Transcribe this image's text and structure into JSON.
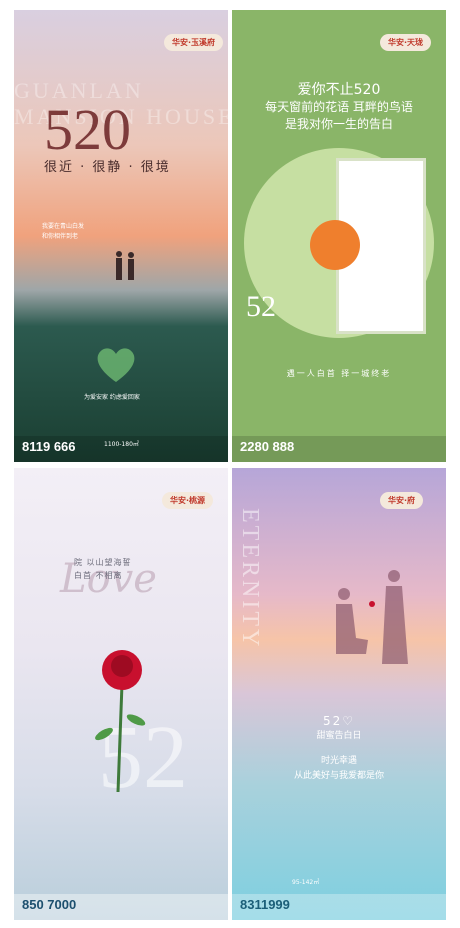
{
  "poster1": {
    "badge": "华安·玉溪府",
    "ghost_lines": [
      "GUANLAN",
      "MANSION HOUSE"
    ],
    "big": "520",
    "tagline": "很近 · 很静 · 很境",
    "small_lines": [
      "我要在青山白发",
      "和你相伴到老"
    ],
    "heart_caption": "为爱安家 约虑爱回家",
    "area": "1100-180㎡",
    "phone": "8119 666"
  },
  "poster2": {
    "badge": "华安·天珑",
    "headline": [
      "爱你不止520",
      "每天窗前的花语 耳畔的鸟语",
      "是我对你一生的告白"
    ],
    "big": "52",
    "slogan": "遇一人白首 择一城终老",
    "phone": "2280 888"
  },
  "poster3": {
    "badge": "华安·桃源",
    "verse": [
      "院 以山望海誓",
      "白首 不相离"
    ],
    "love": "Love",
    "phone": "850 7000"
  },
  "poster4": {
    "badge": "华安·府",
    "vertical": "ETERNITY",
    "mid": [
      "52♡",
      "甜蜜告白日",
      "时光幸遇",
      "从此美好与我爱都是你"
    ],
    "area": "95-142㎡",
    "phone": "8311999"
  },
  "colors": {
    "brand_red": "#c0392b",
    "cream": "#f4e9dc"
  }
}
